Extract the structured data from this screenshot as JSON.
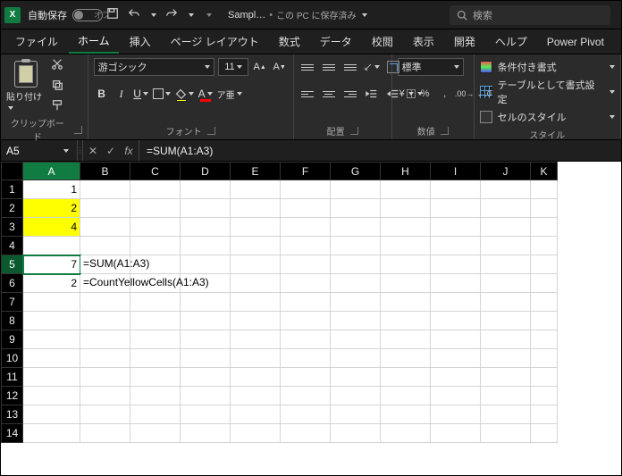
{
  "titlebar": {
    "autosave_label": "自動保存",
    "autosave_state": "オフ",
    "filename": "Sampl…",
    "saved_status": "この PC に保存済み",
    "search_placeholder": "検索"
  },
  "tabs": [
    "ファイル",
    "ホーム",
    "挿入",
    "ページ レイアウト",
    "数式",
    "データ",
    "校閲",
    "表示",
    "開発",
    "ヘルプ",
    "Power Pivot"
  ],
  "active_tab_index": 1,
  "ribbon": {
    "clipboard": {
      "paste": "貼り付け",
      "label": "クリップボード"
    },
    "font": {
      "name": "游ゴシック",
      "size": "11",
      "label": "フォント",
      "fill_color": "#ffff00",
      "font_color": "#ff0000"
    },
    "alignment": {
      "label": "配置"
    },
    "number": {
      "format": "標準",
      "label": "数値"
    },
    "styles": {
      "cond_fmt": "条件付き書式",
      "table_fmt": "テーブルとして書式設定",
      "cell_styles": "セルのスタイル",
      "label": "スタイル"
    }
  },
  "fxbar": {
    "name": "A5",
    "formula": "=SUM(A1:A3)"
  },
  "sheet": {
    "columns": [
      "A",
      "B",
      "C",
      "D",
      "E",
      "F",
      "G",
      "H",
      "I",
      "J",
      "K"
    ],
    "rows": [
      "1",
      "2",
      "3",
      "4",
      "5",
      "6",
      "7",
      "8",
      "9",
      "10",
      "11",
      "12",
      "13",
      "14"
    ],
    "selected": {
      "col": "A",
      "row": "5"
    },
    "cells": {
      "A1": {
        "v": "1",
        "t": "num"
      },
      "A2": {
        "v": "2",
        "t": "num",
        "fill": "yellow"
      },
      "A3": {
        "v": "4",
        "t": "num",
        "fill": "yellow"
      },
      "A5": {
        "v": "7",
        "t": "num",
        "active": true
      },
      "B5": {
        "v": "=SUM(A1:A3)",
        "t": "text",
        "overflow": true
      },
      "A6": {
        "v": "2",
        "t": "num"
      },
      "B6": {
        "v": "=CountYellowCells(A1:A3)",
        "t": "text",
        "overflow": true
      }
    }
  },
  "chart_data": {
    "type": "table",
    "description": "Spreadsheet cells visible in the Excel grid",
    "columns": [
      "A",
      "B"
    ],
    "rows": [
      {
        "row": 1,
        "A": 1
      },
      {
        "row": 2,
        "A": 2
      },
      {
        "row": 3,
        "A": 4
      },
      {
        "row": 5,
        "A": 7,
        "B": "=SUM(A1:A3)"
      },
      {
        "row": 6,
        "A": 2,
        "B": "=CountYellowCells(A1:A3)"
      }
    ]
  }
}
